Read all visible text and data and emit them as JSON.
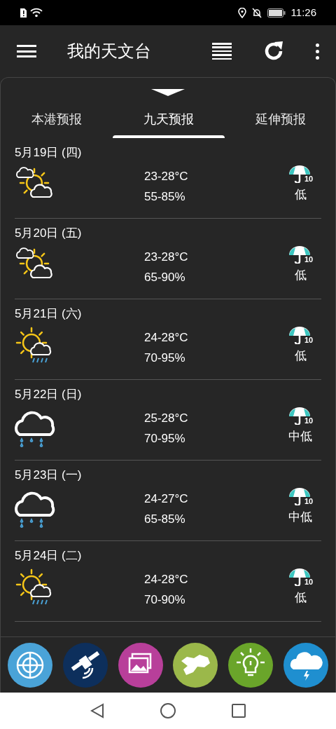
{
  "status_bar": {
    "time": "11:26"
  },
  "toolbar": {
    "title": "我的天文台"
  },
  "tabs": [
    {
      "label": "本港预报",
      "selected": false
    },
    {
      "label": "九天预报",
      "selected": true
    },
    {
      "label": "延伸预报",
      "selected": false
    }
  ],
  "forecast": [
    {
      "date": "5月19日 (四)",
      "kind": "sunny_periods",
      "temperature": "23-28°C",
      "humidity": "55-85%",
      "psr_badge": "10",
      "psr": "低"
    },
    {
      "date": "5月20日 (五)",
      "kind": "sunny_periods",
      "temperature": "23-28°C",
      "humidity": "65-90%",
      "psr_badge": "10",
      "psr": "低"
    },
    {
      "date": "5月21日 (六)",
      "kind": "sunny_showers",
      "temperature": "24-28°C",
      "humidity": "70-95%",
      "psr_badge": "10",
      "psr": "低"
    },
    {
      "date": "5月22日 (日)",
      "kind": "showers",
      "temperature": "25-28°C",
      "humidity": "70-95%",
      "psr_badge": "10",
      "psr": "中低"
    },
    {
      "date": "5月23日 (一)",
      "kind": "showers",
      "temperature": "24-27°C",
      "humidity": "65-85%",
      "psr_badge": "10",
      "psr": "中低"
    },
    {
      "date": "5月24日 (二)",
      "kind": "sunny_showers",
      "temperature": "24-28°C",
      "humidity": "70-90%",
      "psr_badge": "10",
      "psr": "低"
    }
  ],
  "shortcuts": [
    {
      "kind": "radar",
      "color": "#4aa3d8"
    },
    {
      "kind": "satellite",
      "color": "#0d2f5c"
    },
    {
      "kind": "photos",
      "color": "#b83f9a"
    },
    {
      "kind": "map",
      "color": "#9bb84a"
    },
    {
      "kind": "tips",
      "color": "#6aa52a"
    },
    {
      "kind": "warning",
      "color": "#1f8fd0"
    }
  ]
}
